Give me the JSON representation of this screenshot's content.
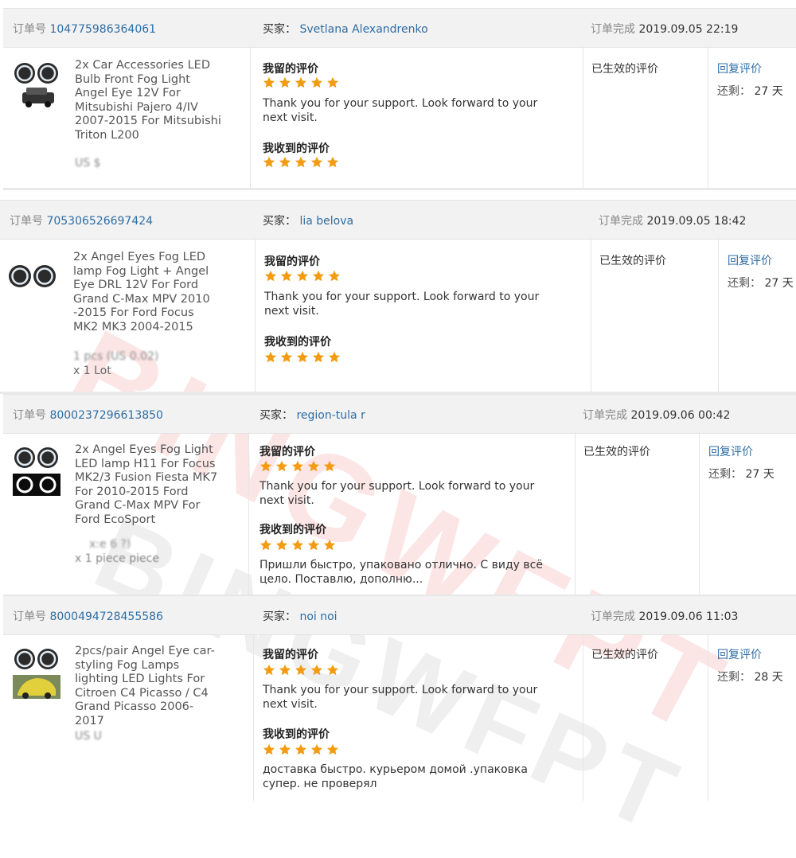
{
  "labels": {
    "order_no": "订单号",
    "buyer": "买家：",
    "completed": "订单完成",
    "my_review": "我留的评价",
    "received_review": "我收到的评价",
    "effective": "已生效的评价",
    "reply": "回复评价",
    "remaining": "还剩："
  },
  "watermark": "BINGWFPT",
  "star_color": "#f39c12",
  "orders": [
    {
      "order_id": "104775986364061",
      "buyer": "Svetlana Alexandrenko",
      "completed_at": "2019.09.05 22:19",
      "product": "2x Car Accessories LED Bulb Front Fog Light Angel Eye 12V For Mitsubishi Pajero 4/IV 2007-2015 For Mitsubishi Triton L200",
      "price_line": "US $",
      "qty_line": "",
      "my_rating": 5,
      "my_comment": "Thank you for your support. Look forward to your next visit.",
      "received_rating": 5,
      "received_comment": "",
      "days_left": "27 天"
    },
    {
      "order_id": "705306526697424",
      "buyer": "lia belova",
      "completed_at": "2019.09.05 18:42",
      "product": "2x Angel Eyes Fog LED lamp Fog Light + Angel Eye DRL 12V For Ford Grand C-Max MPV 2010 -2015 For Ford Focus MK2 MK3 2004-2015",
      "price_line": "1 pcs (US 0.02)",
      "qty_line": "x 1 Lot",
      "my_rating": 5,
      "my_comment": "Thank you for your support. Look forward to your next visit.",
      "received_rating": 5,
      "received_comment": "",
      "days_left": "27 天"
    },
    {
      "order_id": "8000237296613850",
      "buyer": "region-tula r",
      "completed_at": "2019.09.06 00:42",
      "product": "2x Angel Eyes Fog Light LED lamp H11 For Focus MK2/3 Fusion Fiesta MK7 For 2010-2015 Ford Grand C-Max MPV For Ford EcoSport",
      "price_line": "x:e 6 ?)",
      "qty_line": "x 1 piece piece",
      "my_rating": 5,
      "my_comment": "Thank you for your support. Look forward to your next visit.",
      "received_rating": 5,
      "received_comment": "Пришли быстро, упаковано отлично. С виду всё цело. Поставлю, дополню...",
      "days_left": "27 天"
    },
    {
      "order_id": "8000494728455586",
      "buyer": "noi noi",
      "completed_at": "2019.09.06 11:03",
      "product": "2pcs/pair Angel Eye car-styling Fog Lamps lighting LED Lights For Citroen C4 Picasso / C4 Grand Picasso 2006-2017",
      "price_line": "US U",
      "qty_line": "",
      "my_rating": 5,
      "my_comment": "Thank you for your support. Look forward to your next visit.",
      "received_rating": 5,
      "received_comment": "доставка быстро. курьером домой .упаковка супер. не проверял",
      "days_left": "28 天"
    }
  ]
}
